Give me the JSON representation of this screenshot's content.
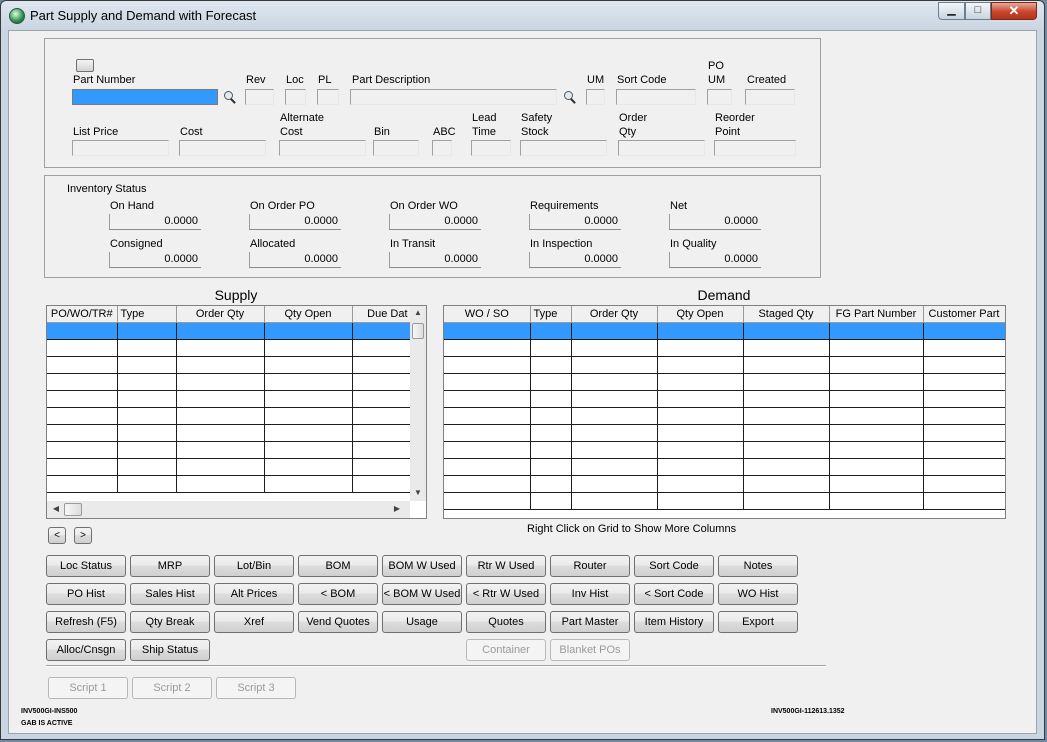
{
  "window": {
    "title": "Part Supply and Demand with Forecast",
    "minimize_glyph": "▁",
    "maximize_glyph": "□",
    "close_glyph": "✕"
  },
  "part_info": {
    "part_number_label": "Part Number",
    "part_number": "",
    "rev_label": "Rev",
    "loc_label": "Loc",
    "pl_label": "PL",
    "description_label": "Part Description",
    "um_label": "UM",
    "sort_code_label": "Sort Code",
    "po_um_label_1": "PO",
    "po_um_label_2": "UM",
    "created_label": "Created",
    "list_price_label": "List Price",
    "cost_label": "Cost",
    "alt_cost_label_1": "Alternate",
    "alt_cost_label_2": "Cost",
    "bin_label": "Bin",
    "abc_label": "ABC",
    "lead_time_label_1": "Lead",
    "lead_time_label_2": "Time",
    "safety_stock_label_1": "Safety",
    "safety_stock_label_2": "Stock",
    "order_qty_label_1": "Order",
    "order_qty_label_2": "Qty",
    "reorder_point_label_1": "Reorder",
    "reorder_point_label_2": "Point"
  },
  "inventory_status": {
    "title": "Inventory Status",
    "items": [
      {
        "label": "On Hand",
        "value": "0.0000"
      },
      {
        "label": "On Order PO",
        "value": "0.0000"
      },
      {
        "label": "On Order WO",
        "value": "0.0000"
      },
      {
        "label": "Requirements",
        "value": "0.0000"
      },
      {
        "label": "Net",
        "value": "0.0000"
      },
      {
        "label": "Consigned",
        "value": "0.0000"
      },
      {
        "label": "Allocated",
        "value": "0.0000"
      },
      {
        "label": "In Transit",
        "value": "0.0000"
      },
      {
        "label": "In Inspection",
        "value": "0.0000"
      },
      {
        "label": "In Quality",
        "value": "0.0000"
      }
    ]
  },
  "supply": {
    "title": "Supply",
    "columns": [
      "PO/WO/TR#",
      "Type",
      "Order Qty",
      "Qty Open",
      "Due Dat"
    ]
  },
  "demand": {
    "title": "Demand",
    "columns": [
      "WO / SO",
      "Type",
      "Order Qty",
      "Qty Open",
      "Staged Qty",
      "FG Part Number",
      "Customer Part"
    ]
  },
  "nav": {
    "prev": "<",
    "next": ">",
    "hint": "Right Click on Grid to Show More Columns"
  },
  "buttons": {
    "row1": [
      "Loc Status",
      "MRP",
      "Lot/Bin",
      "BOM",
      "BOM W Used",
      "Rtr W Used",
      "Router",
      "Sort Code",
      "Notes"
    ],
    "row2": [
      "PO Hist",
      "Sales Hist",
      "Alt Prices",
      "< BOM",
      "< BOM W Used",
      "< Rtr W Used",
      "Inv Hist",
      "< Sort Code",
      "WO Hist"
    ],
    "row3": [
      "Refresh (F5)",
      "Qty Break",
      "Xref",
      "Vend Quotes",
      "Usage",
      "Quotes",
      "Part Master",
      "Item History",
      "Export"
    ],
    "row4": [
      "Alloc/Cnsgn",
      "Ship Status"
    ],
    "row4_disabled": [
      "Container",
      "Blanket POs"
    ],
    "scripts": [
      "Script 1",
      "Script 2",
      "Script 3"
    ]
  },
  "footer": {
    "left_line1": "INV500GI-INS500",
    "left_line2": "GAB IS ACTIVE",
    "right": "INV500GI-112613.1352"
  }
}
